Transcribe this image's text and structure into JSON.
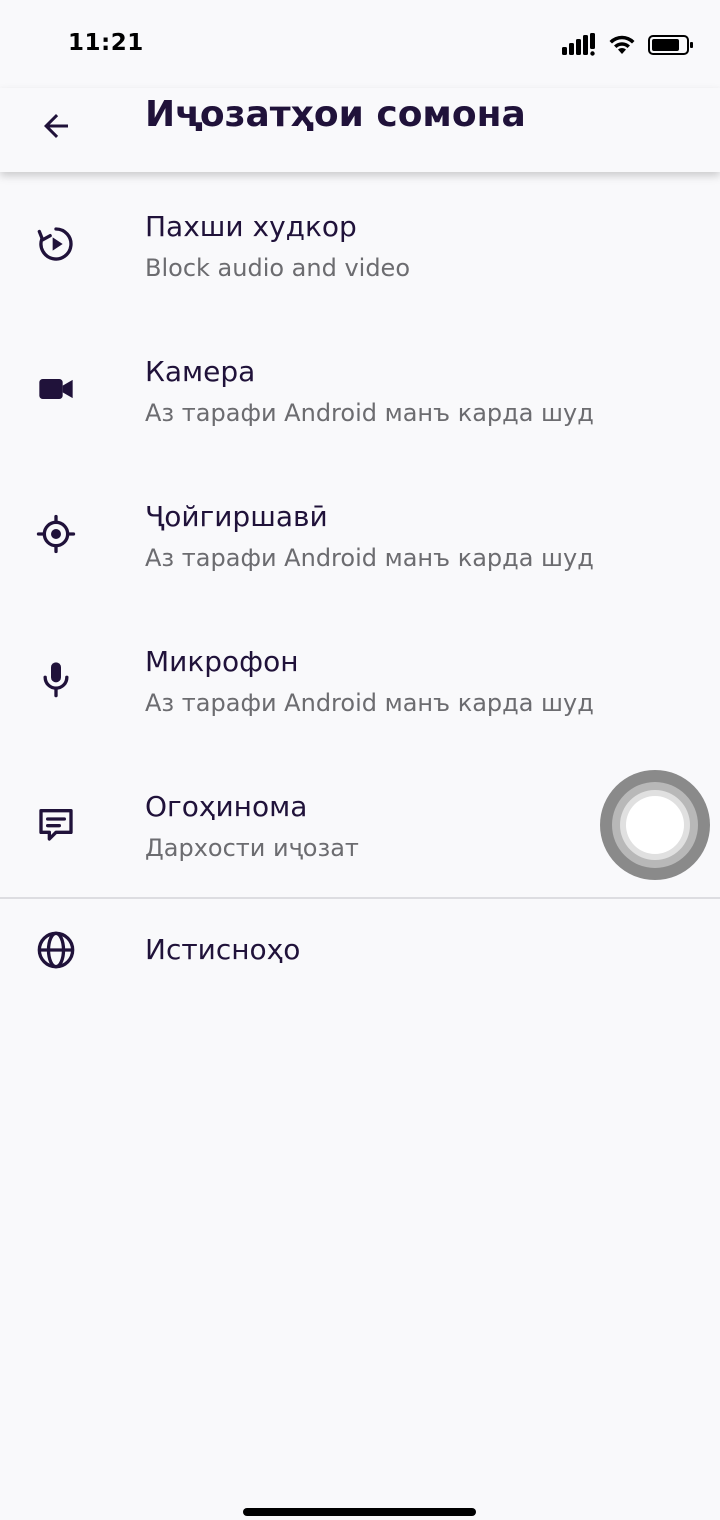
{
  "status_bar": {
    "time": "11:21"
  },
  "toolbar": {
    "title": "Иҷозатҳои сомона",
    "back_icon": "arrow-back-icon"
  },
  "permissions": [
    {
      "title": "Пахши худкор",
      "subtitle": "Block audio and video",
      "icon": "autoplay-icon"
    },
    {
      "title": "Камера",
      "subtitle": "Аз тарафи Android манъ карда шуд",
      "icon": "camera-icon"
    },
    {
      "title": "Ҷойгиршавӣ",
      "subtitle": "Аз тарафи Android манъ карда шуд",
      "icon": "location-icon"
    },
    {
      "title": "Микрофон",
      "subtitle": "Аз тарафи Android манъ карда шуд",
      "icon": "microphone-icon"
    },
    {
      "title": "Огоҳинома",
      "subtitle": "Дархости иҷозат",
      "icon": "notification-icon"
    }
  ],
  "exceptions": {
    "title": "Истисноҳо",
    "icon": "globe-icon"
  },
  "colors": {
    "accent": "#20123a",
    "background": "#f9f9fb",
    "subtitle": "#6c6c70"
  }
}
